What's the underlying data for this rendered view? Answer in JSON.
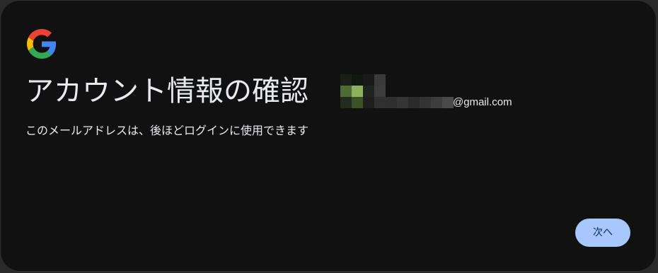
{
  "dialog": {
    "logo_icon": "google-g-icon",
    "title": "アカウント情報の確認",
    "description": "このメールアドレスは、後ほどログインに使用できます"
  },
  "account": {
    "avatar_icon": "pixelated-avatar-icon",
    "email_suffix": "@gmail.com"
  },
  "actions": {
    "next_label": "次へ"
  },
  "colors": {
    "background": "#111111",
    "text": "#e8eaed",
    "button_bg": "#a8c7fa",
    "button_text": "#062e6f"
  }
}
